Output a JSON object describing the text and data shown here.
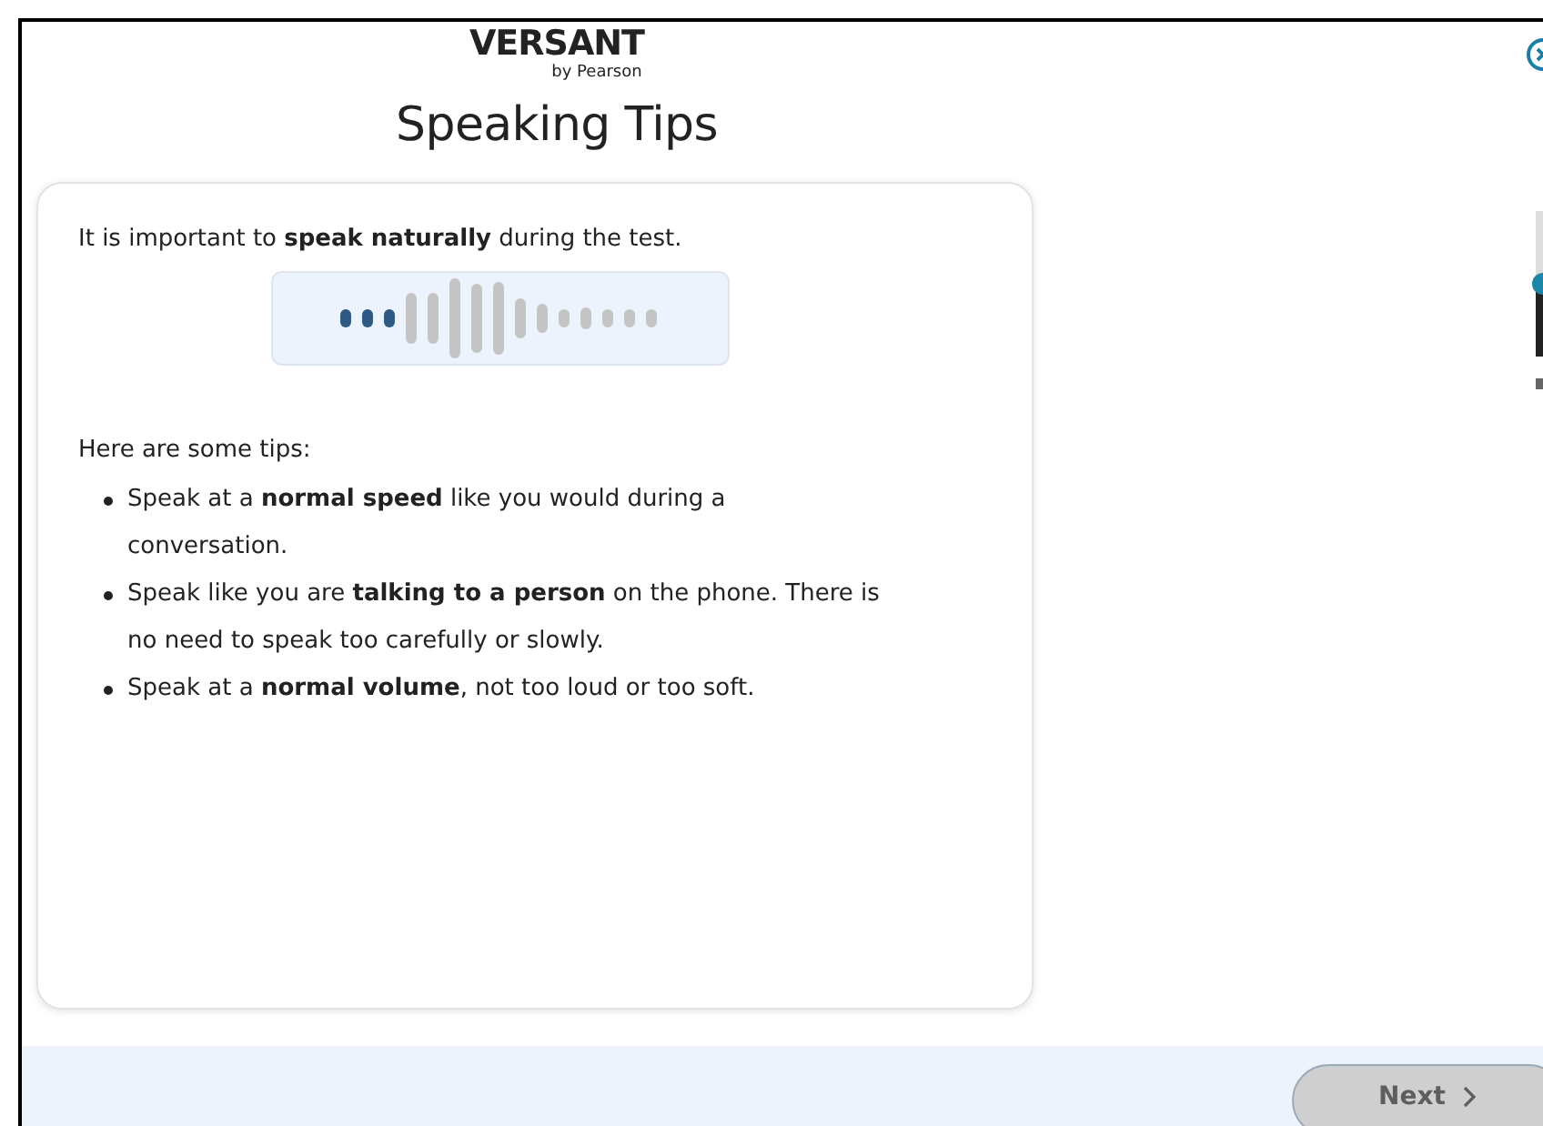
{
  "header": {
    "logo": "VERSANT",
    "logo_sub": "by Pearson",
    "title": "Speaking Tips"
  },
  "card": {
    "intro": "It is important to **speak naturally** during the test.",
    "tips_heading": "Here are some tips:",
    "tips": [
      "Speak at a **normal speed** like you would during a conversation.",
      "Speak like you are **talking to a person** on the phone. There is no need to speak too carefully or slowly.",
      "Speak at a **normal volume**, not too loud or too soft."
    ]
  },
  "volume": {
    "level": 0.5
  },
  "next_button": {
    "label": "Next",
    "disabled": true
  }
}
